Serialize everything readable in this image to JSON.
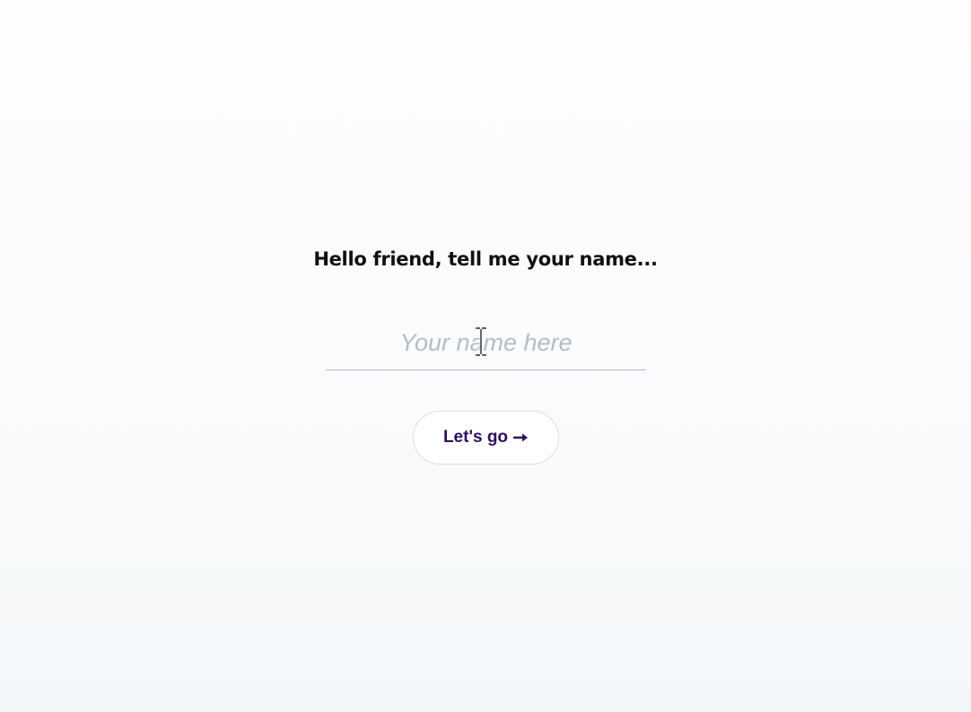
{
  "page": {
    "heading": "Hello friend, tell me your name...",
    "name_input": {
      "value": "",
      "placeholder": "Your name here"
    },
    "submit_button": {
      "label": "Let's go",
      "icon": "arrow-right-icon"
    },
    "cursor": {
      "icon": "text-cursor-icon"
    }
  },
  "colors": {
    "heading_text": "#111111",
    "button_text": "#2d0f5e",
    "placeholder": "#b6bcc6",
    "input_underline": "#b9b3d6",
    "button_border": "#dedde6"
  }
}
